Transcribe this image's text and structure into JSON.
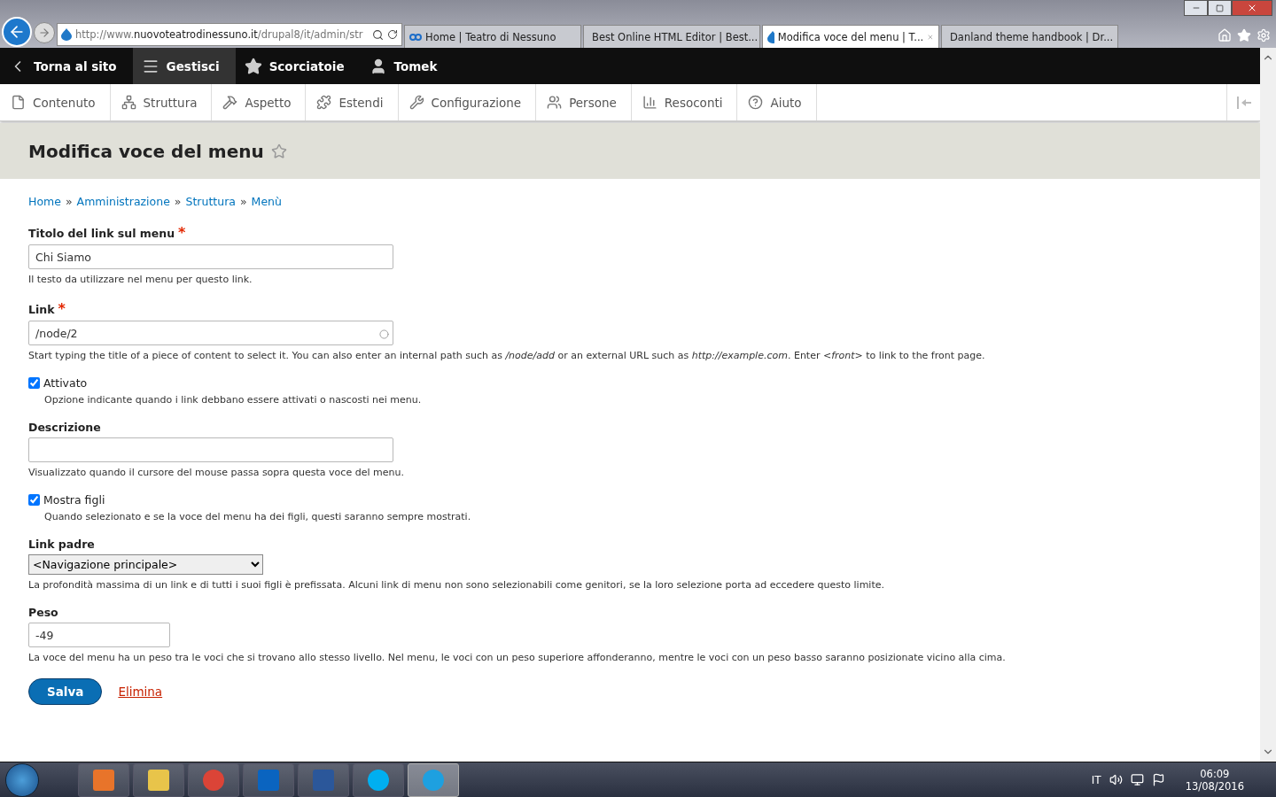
{
  "browser": {
    "url_prefix": "http://www.",
    "url_domain": "nuovoteatrodinessuno.it",
    "url_path": "/drupal8/it/admin/str",
    "tabs": [
      {
        "label": "Home | Teatro di Nessuno",
        "kind": "site",
        "selected": false
      },
      {
        "label": "Best Online HTML Editor | Best...",
        "kind": "ie",
        "selected": false
      },
      {
        "label": "Modifica voce del menu | T...",
        "kind": "drupal",
        "selected": true
      },
      {
        "label": "Danland theme handbook | Dr...",
        "kind": "drupal",
        "selected": false
      }
    ]
  },
  "toolbar": {
    "items": [
      {
        "label": "Torna al sito",
        "kind": "back",
        "selected": false
      },
      {
        "label": "Gestisci",
        "kind": "menu",
        "selected": true
      },
      {
        "label": "Scorciatoie",
        "kind": "star",
        "selected": false
      },
      {
        "label": "Tomek",
        "kind": "user",
        "selected": false
      }
    ]
  },
  "tray": {
    "items": [
      {
        "label": "Contenuto",
        "kind": "file"
      },
      {
        "label": "Struttura",
        "kind": "structure"
      },
      {
        "label": "Aspetto",
        "kind": "hammer"
      },
      {
        "label": "Estendi",
        "kind": "puzzle"
      },
      {
        "label": "Configurazione",
        "kind": "wrench"
      },
      {
        "label": "Persone",
        "kind": "people"
      },
      {
        "label": "Resoconti",
        "kind": "chart"
      },
      {
        "label": "Aiuto",
        "kind": "help"
      }
    ]
  },
  "page_title": "Modifica voce del menu",
  "breadcrumb": [
    "Home",
    "Amministrazione",
    "Struttura",
    "Menù"
  ],
  "breadcrumb_separator": "»",
  "form": {
    "fields": [
      {
        "kind": "text",
        "label": "Titolo del link sul menu",
        "required_mark": "*",
        "value": "Chi Siamo",
        "description": "Il testo da utilizzare nel menu per questo link."
      },
      {
        "kind": "autocomplete",
        "label": "Link",
        "required_mark": "*",
        "value": "/node/2",
        "description": "Start typing the title of a piece of content to select it. You can also enter an internal path such as */node/add* or an external URL such as *http://example.com*. Enter *<front>* to link to the front page."
      },
      {
        "kind": "checkbox",
        "label": "Attivato",
        "checked": true,
        "description": "Opzione indicante quando i link debbano essere attivati o nascosti nei menu."
      },
      {
        "kind": "text",
        "label": "Descrizione",
        "description": "Visualizzato quando il cursore del mouse passa sopra questa voce del menu."
      },
      {
        "kind": "checkbox",
        "label": "Mostra figli",
        "checked": true,
        "description": "Quando selezionato e se la voce del menu ha dei figli, questi saranno sempre mostrati."
      },
      {
        "kind": "select",
        "label": "Link padre",
        "value": "<Navigazione principale>",
        "description": "La profondità massima di un link e di tutti i suoi figli è prefissata. Alcuni link di menu non sono selezionabili come genitori, se la loro selezione porta ad eccedere questo limite."
      },
      {
        "kind": "number",
        "label": "Peso",
        "value": "-49",
        "description": "La voce del menu ha un peso tra le voci che si trovano allo stesso livello. Nel menu, le voci con un peso superiore affonderanno, mentre le voci con un peso basso saranno posizionate vicino alla cima."
      }
    ],
    "save": "Salva",
    "delete": "Elimina"
  },
  "taskbar": {
    "apps": [
      {
        "kind": "media",
        "selected": false
      },
      {
        "kind": "folder",
        "selected": false
      },
      {
        "kind": "chrome",
        "selected": false
      },
      {
        "kind": "outlook",
        "selected": false
      },
      {
        "kind": "word",
        "selected": false
      },
      {
        "kind": "skype",
        "selected": false
      },
      {
        "kind": "ie",
        "selected": true
      }
    ],
    "language": "IT",
    "time": "06:09",
    "date": "13/08/2016"
  }
}
